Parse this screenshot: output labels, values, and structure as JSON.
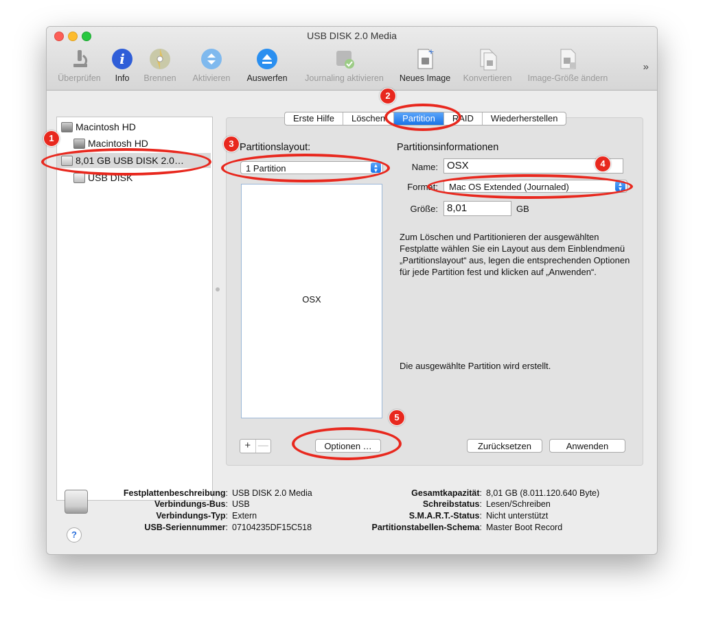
{
  "window": {
    "title": "USB DISK 2.0 Media"
  },
  "toolbar": {
    "items": [
      {
        "label": "Überprüfen",
        "icon": "microscope-icon",
        "enabled": false
      },
      {
        "label": "Info",
        "icon": "info-icon",
        "enabled": true
      },
      {
        "label": "Brennen",
        "icon": "burn-disc-icon",
        "enabled": false
      },
      {
        "label": "Aktivieren",
        "icon": "mount-icon",
        "enabled": false
      },
      {
        "label": "Auswerfen",
        "icon": "eject-icon",
        "enabled": true
      },
      {
        "label": "Journaling aktivieren",
        "icon": "journaling-disk-icon",
        "enabled": false
      },
      {
        "label": "Neues Image",
        "icon": "new-image-icon",
        "enabled": true
      },
      {
        "label": "Konvertieren",
        "icon": "convert-image-icon",
        "enabled": false
      },
      {
        "label": "Image-Größe ändern",
        "icon": "resize-image-icon",
        "enabled": false
      }
    ],
    "overflow": "»"
  },
  "sidebar": {
    "items": [
      {
        "label": "Macintosh HD",
        "level": 0,
        "icon": "hard-disk-icon"
      },
      {
        "label": "Macintosh HD",
        "level": 1,
        "icon": "hard-disk-icon"
      },
      {
        "label": "8,01 GB USB DISK 2.0…",
        "level": 0,
        "icon": "usb-disk-icon",
        "selected": true
      },
      {
        "label": "USB DISK",
        "level": 1,
        "icon": "usb-volume-icon"
      }
    ]
  },
  "tabs": [
    {
      "label": "Erste Hilfe",
      "active": false
    },
    {
      "label": "Löschen",
      "active": false
    },
    {
      "label": "Partition",
      "active": true
    },
    {
      "label": "RAID",
      "active": false
    },
    {
      "label": "Wiederherstellen",
      "active": false
    }
  ],
  "partition": {
    "layout_label": "Partitionslayout:",
    "layout_value": "1 Partition",
    "partition_name": "OSX",
    "info_title": "Partitionsinformationen",
    "name_label": "Name:",
    "name_value": "OSX",
    "format_label": "Format:",
    "format_value": "Mac OS Extended (Journaled)",
    "size_label": "Größe:",
    "size_value": "8,01",
    "size_unit": "GB",
    "description": "Zum Löschen und Partitionieren der ausgewählten Festplatte wählen Sie ein Layout aus dem Einblendmenü „Partitionslayout“ aus, legen die entsprechenden Optionen für jede Partition fest und klicken auf „Anwenden“.",
    "status": "Die ausgewählte Partition wird erstellt.",
    "add": "+",
    "remove": "—",
    "options_button": "Optionen …",
    "revert_button": "Zurücksetzen",
    "apply_button": "Anwenden"
  },
  "info": {
    "left": [
      {
        "key": "Festplattenbeschreibung",
        "value": "USB DISK 2.0 Media"
      },
      {
        "key": "Verbindungs-Bus",
        "value": "USB"
      },
      {
        "key": "Verbindungs-Typ",
        "value": "Extern"
      },
      {
        "key": "USB-Seriennummer",
        "value": "07104235DF15C518"
      }
    ],
    "right": [
      {
        "key": "Gesamtkapazität",
        "value": "8,01 GB (8.011.120.640 Byte)"
      },
      {
        "key": "Schreibstatus",
        "value": "Lesen/Schreiben"
      },
      {
        "key": "S.M.A.R.T.-Status",
        "value": "Nicht unterstützt"
      },
      {
        "key": "Partitionstabellen-Schema",
        "value": "Master Boot Record"
      }
    ],
    "help": "?"
  },
  "annotations": [
    "1",
    "2",
    "3",
    "4",
    "5"
  ],
  "colors": {
    "accent": "#1a74e8",
    "annotation": "#e8281e"
  }
}
